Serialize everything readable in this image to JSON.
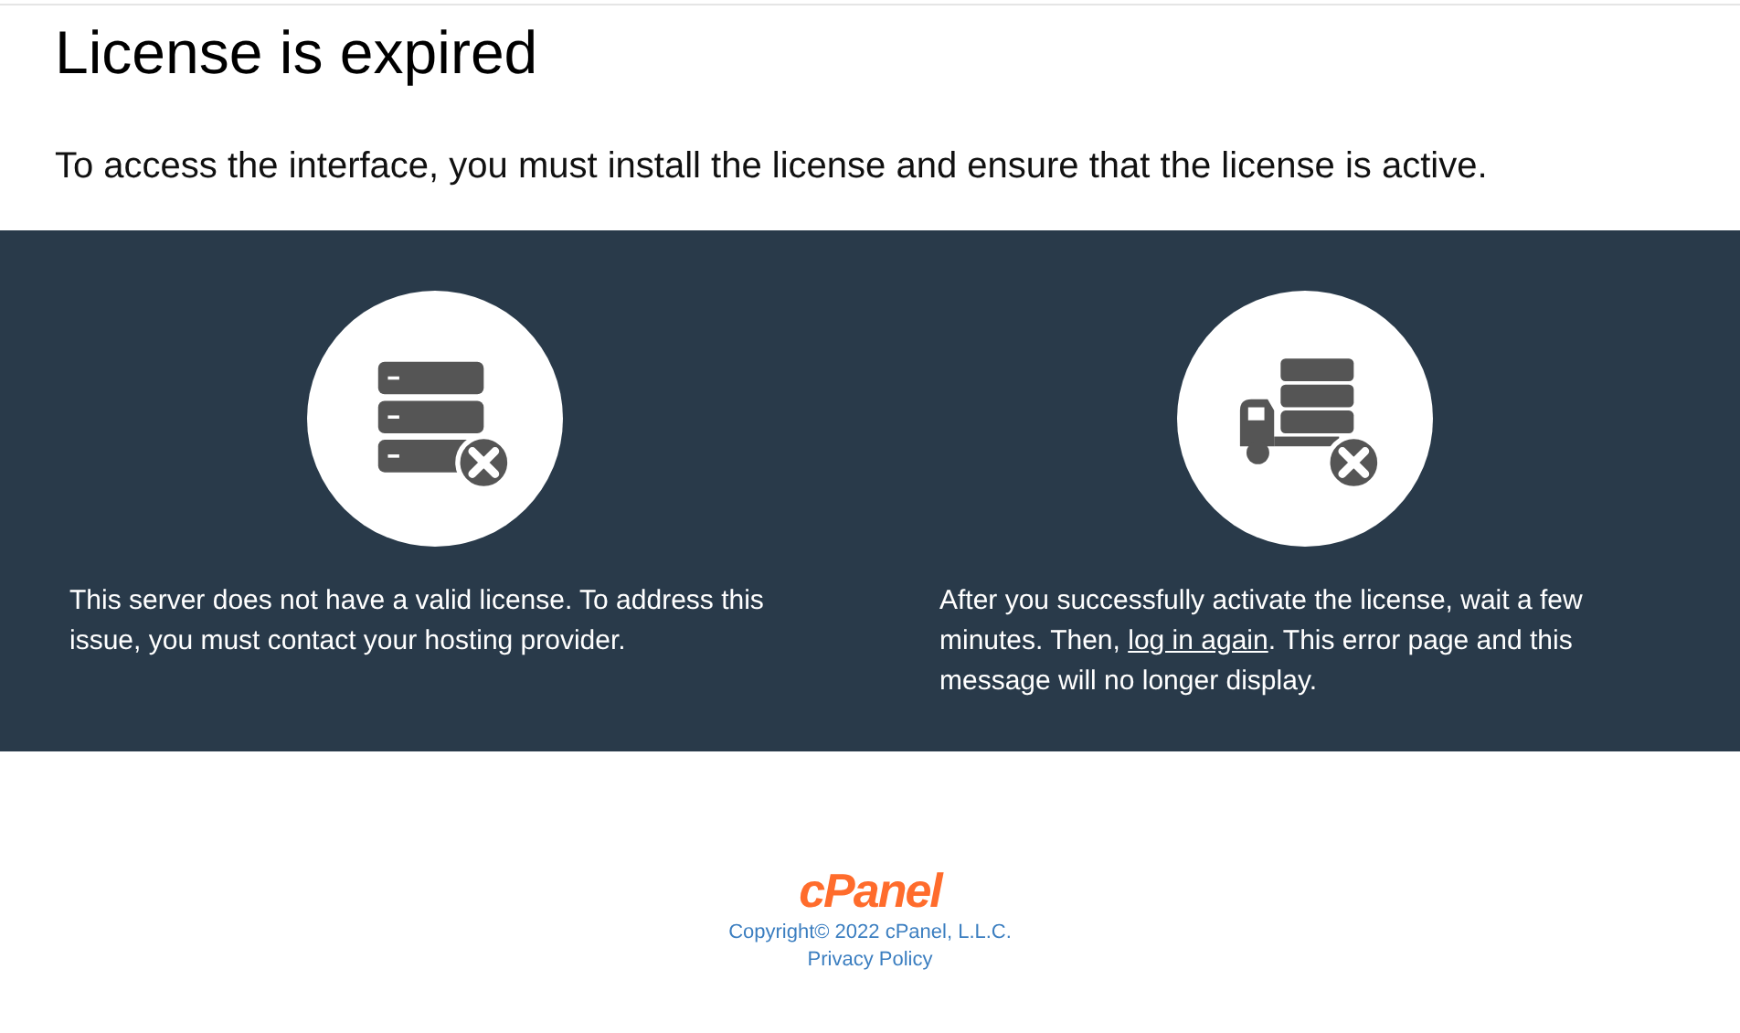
{
  "header": {
    "title": "License is expired",
    "message": "To access the interface, you must install the license and ensure that the license is active."
  },
  "panels": [
    {
      "kind": "server",
      "text": "This server does not have a valid license. To address this issue, you must contact your hosting provider."
    },
    {
      "kind": "truck",
      "text_before": "After you successfully activate the license, wait a few minutes. Then, ",
      "link": "log in again",
      "text_after": ". This error page and this message will no longer display."
    }
  ],
  "footer": {
    "logo": "cPanel",
    "copyright": "Copyright© 2022 cPanel, L.L.C.",
    "privacy_link": "Privacy Policy"
  }
}
